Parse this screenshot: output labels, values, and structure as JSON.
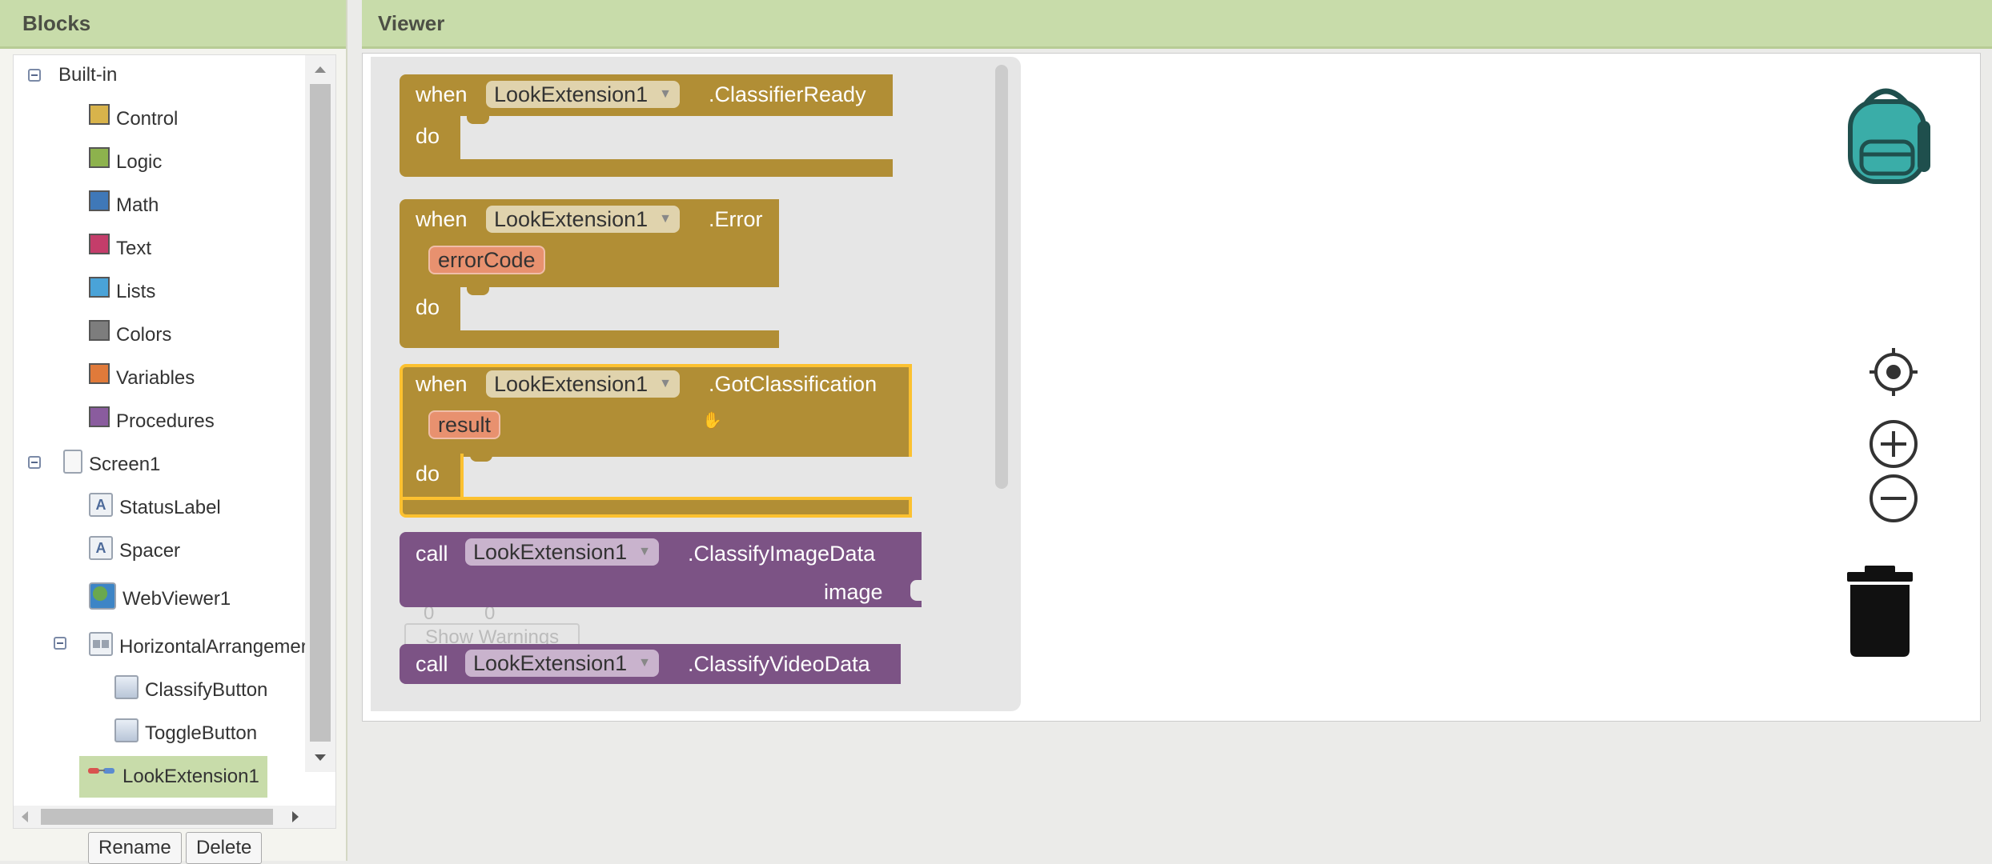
{
  "blocks_panel": {
    "title": "Blocks",
    "builtin": {
      "label": "Built-in",
      "items": [
        {
          "label": "Control",
          "color": "#d8b34b"
        },
        {
          "label": "Logic",
          "color": "#8db24d"
        },
        {
          "label": "Math",
          "color": "#3f78b8"
        },
        {
          "label": "Text",
          "color": "#c43d6a"
        },
        {
          "label": "Lists",
          "color": "#4aa3d8"
        },
        {
          "label": "Colors",
          "color": "#7d7d7d"
        },
        {
          "label": "Variables",
          "color": "#e07a3a"
        },
        {
          "label": "Procedures",
          "color": "#8a5c9e"
        }
      ]
    },
    "screen": {
      "label": "Screen1",
      "components": [
        "StatusLabel",
        "Spacer",
        "WebViewer1"
      ],
      "arrangement": {
        "label": "HorizontalArrangemer",
        "children": [
          "ClassifyButton",
          "ToggleButton"
        ]
      },
      "extension": "LookExtension1"
    },
    "rename_label": "Rename",
    "delete_label": "Delete"
  },
  "viewer": {
    "title": "Viewer",
    "blocks": {
      "when_kw": "when",
      "do_kw": "do",
      "call_kw": "call",
      "component": "LookExtension1",
      "classifier_ready": ".ClassifierReady",
      "error": ".Error",
      "error_param": "errorCode",
      "got_classification": ".GotClassification",
      "result_param": "result",
      "classify_image": ".ClassifyImageData",
      "image_socket": "image",
      "classify_video": ".ClassifyVideoData"
    },
    "warnings": {
      "warning_count": "0",
      "error_count": "0",
      "show_warnings_label": "Show Warnings"
    }
  },
  "colors": {
    "header_bg": "#c8dcaa",
    "event_block": "#b18e35",
    "method_block": "#7c5385",
    "selection": "#fcc130",
    "backpack": "#3aada8"
  }
}
